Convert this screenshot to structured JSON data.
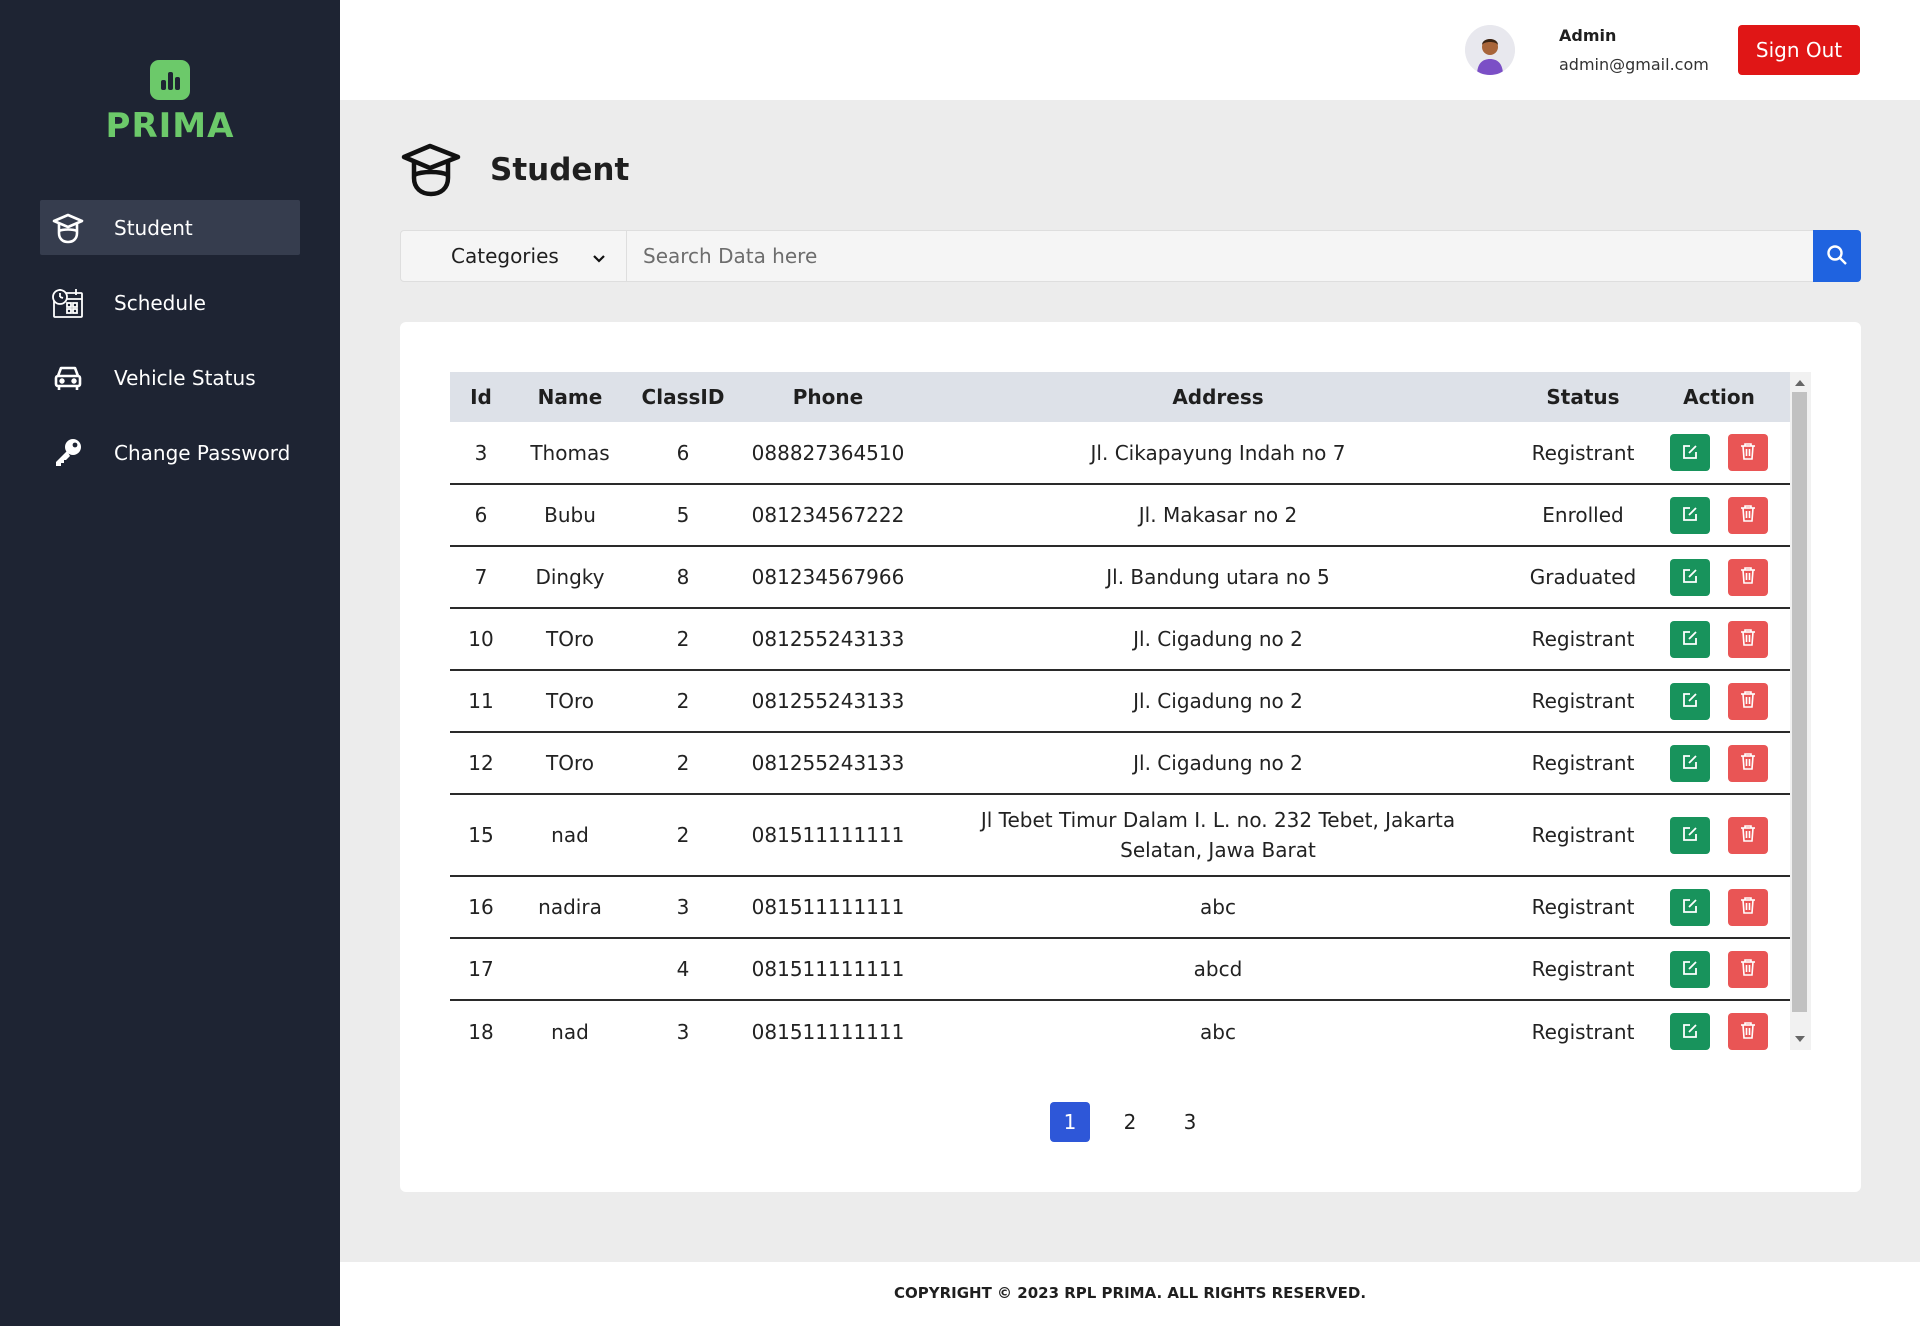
{
  "brand": {
    "name": "PRIMA",
    "color": "#6cc96a"
  },
  "sidebar": {
    "items": [
      {
        "label": "Student",
        "icon": "graduate-icon",
        "active": true
      },
      {
        "label": "Schedule",
        "icon": "calendar-clock-icon",
        "active": false
      },
      {
        "label": "Vehicle Status",
        "icon": "car-icon",
        "active": false
      },
      {
        "label": "Change Password",
        "icon": "key-icon",
        "active": false
      }
    ]
  },
  "header": {
    "user_name": "Admin",
    "user_email": "admin@gmail.com",
    "signout_label": "Sign Out"
  },
  "page": {
    "title": "Student",
    "icon": "graduate-icon"
  },
  "search": {
    "category_label": "Categories",
    "placeholder": "Search Data here"
  },
  "table": {
    "columns": [
      "Id",
      "Name",
      "ClassID",
      "Phone",
      "Address",
      "Status",
      "Action"
    ],
    "rows": [
      {
        "id": "3",
        "name": "Thomas",
        "class_id": "6",
        "phone": "088827364510",
        "address": "Jl. Cikapayung Indah no 7",
        "status": "Registrant"
      },
      {
        "id": "6",
        "name": "Bubu",
        "class_id": "5",
        "phone": "081234567222",
        "address": "Jl. Makasar no 2",
        "status": "Enrolled"
      },
      {
        "id": "7",
        "name": "Dingky",
        "class_id": "8",
        "phone": "081234567966",
        "address": "Jl. Bandung utara no 5",
        "status": "Graduated"
      },
      {
        "id": "10",
        "name": "TOro",
        "class_id": "2",
        "phone": "081255243133",
        "address": "Jl. Cigadung no 2",
        "status": "Registrant"
      },
      {
        "id": "11",
        "name": "TOro",
        "class_id": "2",
        "phone": "081255243133",
        "address": "Jl. Cigadung no 2",
        "status": "Registrant"
      },
      {
        "id": "12",
        "name": "TOro",
        "class_id": "2",
        "phone": "081255243133",
        "address": "Jl. Cigadung no 2",
        "status": "Registrant"
      },
      {
        "id": "15",
        "name": "nad",
        "class_id": "2",
        "phone": "081511111111",
        "address": "Jl Tebet Timur Dalam I. L. no. 232 Tebet, Jakarta Selatan, Jawa Barat",
        "status": "Registrant"
      },
      {
        "id": "16",
        "name": "nadira",
        "class_id": "3",
        "phone": "081511111111",
        "address": "abc",
        "status": "Registrant"
      },
      {
        "id": "17",
        "name": "",
        "class_id": "4",
        "phone": "081511111111",
        "address": "abcd",
        "status": "Registrant"
      },
      {
        "id": "18",
        "name": "nad",
        "class_id": "3",
        "phone": "081511111111",
        "address": "abc",
        "status": "Registrant"
      }
    ]
  },
  "pagination": {
    "pages": [
      "1",
      "2",
      "3"
    ],
    "current": "1"
  },
  "footer": {
    "text": "COPYRIGHT © 2023 RPL PRIMA. ALL RIGHTS RESERVED."
  },
  "colors": {
    "sidebar": "#1e2433",
    "signout": "#e01616",
    "edit": "#18935c",
    "delete": "#e95555",
    "search_button": "#1f63e0",
    "active_page": "#2e57d8"
  }
}
